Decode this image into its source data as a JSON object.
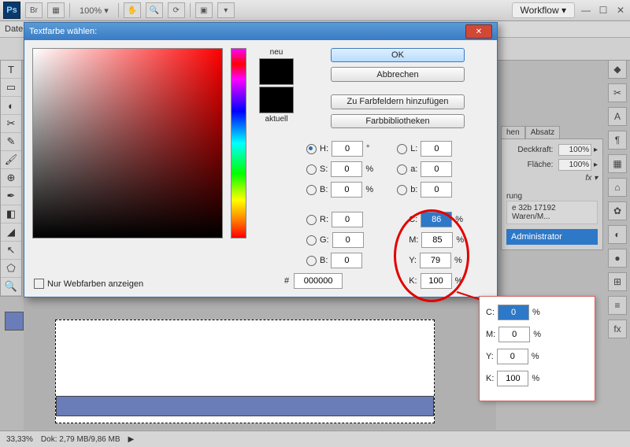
{
  "top": {
    "zoom": "100% ▾",
    "workflow": "Workflow ▾"
  },
  "menu": {
    "file": "Date"
  },
  "panels": {
    "tab_hen": "hen",
    "tab_absatz": "Absatz",
    "opacity_label": "Deckkraft:",
    "opacity_value": "100%",
    "fill_label": "Fläche:",
    "fill_value": "100%",
    "fx": "fx ▾",
    "rung": "rung",
    "layer_text": "e 32b 17192 Waren/M...",
    "layer_active": "Administrator"
  },
  "status": {
    "zoom": "33,33%",
    "doc": "Dok: 2,79 MB/9,86 MB"
  },
  "dialog": {
    "title": "Textfarbe wählen:",
    "ok": "OK",
    "cancel": "Abbrechen",
    "add_swatch": "Zu Farbfeldern hinzufügen",
    "libraries": "Farbbibliotheken",
    "new_label": "neu",
    "current_label": "aktuell",
    "webonly": "Nur Webfarben anzeigen",
    "hex_label": "#",
    "hex_value": "000000",
    "H": {
      "label": "H:",
      "value": "0",
      "unit": "°"
    },
    "S": {
      "label": "S:",
      "value": "0",
      "unit": "%"
    },
    "B": {
      "label": "B:",
      "value": "0",
      "unit": "%"
    },
    "R": {
      "label": "R:",
      "value": "0"
    },
    "G": {
      "label": "G:",
      "value": "0"
    },
    "Bb": {
      "label": "B:",
      "value": "0"
    },
    "L": {
      "label": "L:",
      "value": "0"
    },
    "a": {
      "label": "a:",
      "value": "0"
    },
    "b": {
      "label": "b:",
      "value": "0"
    },
    "C": {
      "label": "C:",
      "value": "86",
      "unit": "%"
    },
    "M": {
      "label": "M:",
      "value": "85",
      "unit": "%"
    },
    "Y": {
      "label": "Y:",
      "value": "79",
      "unit": "%"
    },
    "K": {
      "label": "K:",
      "value": "100",
      "unit": "%"
    }
  },
  "callout": {
    "C": {
      "label": "C:",
      "value": "0",
      "unit": "%"
    },
    "M": {
      "label": "M:",
      "value": "0",
      "unit": "%"
    },
    "Y": {
      "label": "Y:",
      "value": "0",
      "unit": "%"
    },
    "K": {
      "label": "K:",
      "value": "100",
      "unit": "%"
    }
  }
}
